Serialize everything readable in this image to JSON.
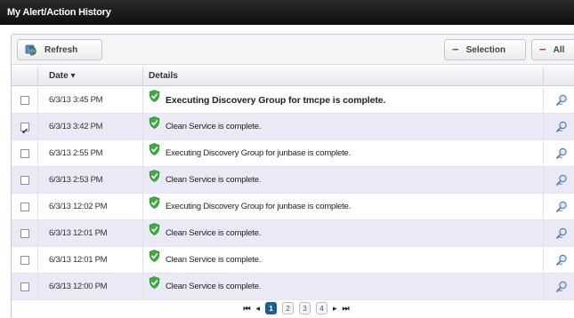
{
  "window": {
    "title": "My Alert/Action History"
  },
  "toolbar": {
    "refresh_label": "Refresh",
    "selection_label": "Selection",
    "all_label": "All",
    "minus_symbol": "−"
  },
  "table": {
    "columns": {
      "date": "Date ▾",
      "details": "Details"
    },
    "rows": [
      {
        "checked": false,
        "date": "6/3/13 3:45 PM",
        "details": "Executing Discovery Group for tmcpe is complete.",
        "bold": true
      },
      {
        "checked": true,
        "date": "6/3/13 3:42 PM",
        "details": "Clean Service is complete.",
        "bold": false
      },
      {
        "checked": false,
        "date": "6/3/13 2:55 PM",
        "details": "Executing Discovery Group for junbase is complete.",
        "bold": false
      },
      {
        "checked": false,
        "date": "6/3/13 2:53 PM",
        "details": "Clean Service is complete.",
        "bold": false
      },
      {
        "checked": false,
        "date": "6/3/13 12:02 PM",
        "details": "Executing Discovery Group for junbase is complete.",
        "bold": false
      },
      {
        "checked": false,
        "date": "6/3/13 12:01 PM",
        "details": "Clean Service is complete.",
        "bold": false
      },
      {
        "checked": false,
        "date": "6/3/13 12:01 PM",
        "details": "Clean Service is complete.",
        "bold": false
      },
      {
        "checked": false,
        "date": "6/3/13 12:00 PM",
        "details": "Clean Service is complete.",
        "bold": false
      }
    ]
  },
  "pager": {
    "first": "⏮",
    "prev": "◂",
    "pages": [
      "1",
      "2",
      "3",
      "4"
    ],
    "current": "1",
    "next": "▸",
    "last": "⏭"
  },
  "colors": {
    "accent": "#1f5e8e",
    "shield": "#3cae3c",
    "alt_row": "#e9eaf6"
  }
}
